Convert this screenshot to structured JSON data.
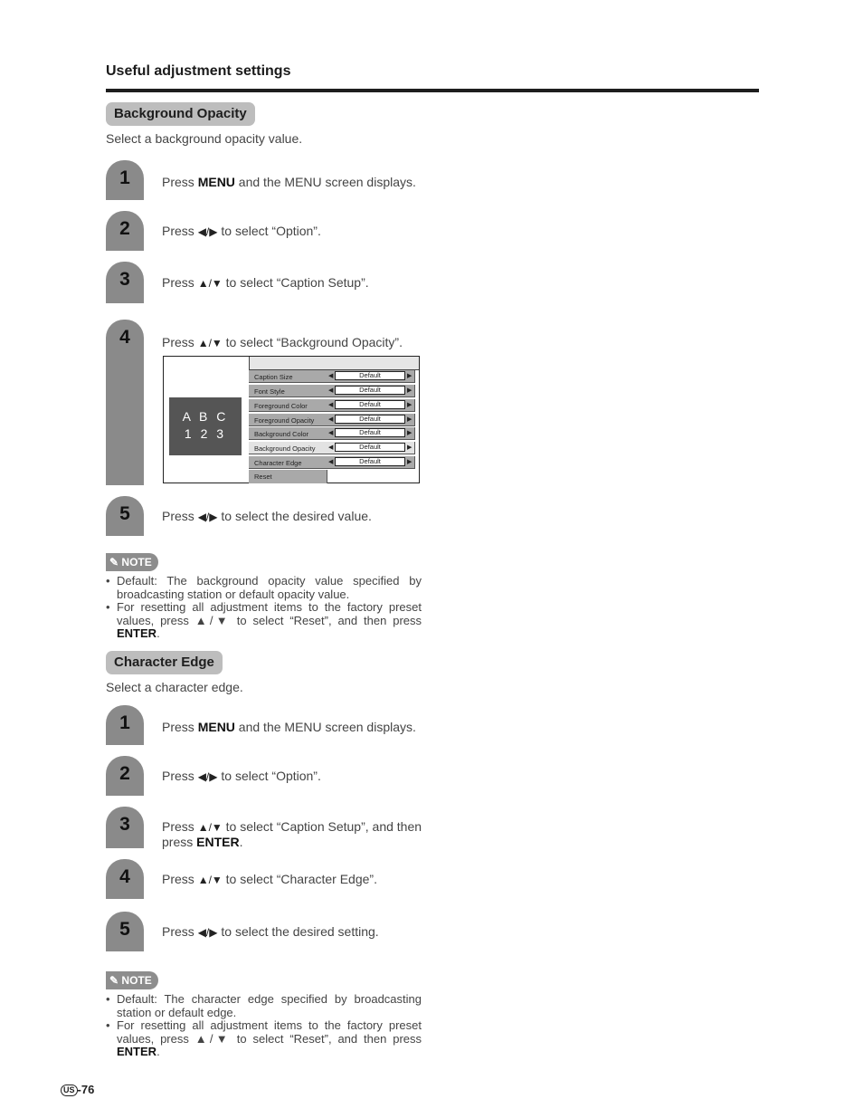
{
  "page_heading": "Useful adjustment settings",
  "sections": [
    {
      "title": "Background Opacity",
      "description": "Select a background opacity value.",
      "steps": [
        {
          "number": "1",
          "pre": "Press ",
          "bold": "MENU",
          "post": " and the MENU screen displays."
        },
        {
          "number": "2",
          "pre": "Press ",
          "glyph": "◀/▶",
          "post": " to select “Option”."
        },
        {
          "number": "3",
          "pre": "Press ",
          "glyph": "▲/▼",
          "post": " to select “Caption Setup”."
        },
        {
          "number": "4",
          "pre": "Press ",
          "glyph": "▲/▼",
          "post": " to select “Background Opacity”."
        },
        {
          "number": "5",
          "pre": "Press ",
          "glyph": "◀/▶",
          "post": " to select the desired value."
        }
      ],
      "note": {
        "badge": "NOTE",
        "items": [
          {
            "text": "Default: The background opacity value specified by broadcasting station or default opacity value."
          },
          {
            "text": "For resetting all adjustment items to the factory preset values, press ▲/▼ to select “Reset”, and then press ",
            "bold": "ENTER",
            "end": "."
          }
        ]
      }
    },
    {
      "title": "Character Edge",
      "description": "Select a character edge.",
      "steps": [
        {
          "number": "1",
          "pre": "Press ",
          "bold": "MENU",
          "post": " and the MENU screen displays."
        },
        {
          "number": "2",
          "pre": "Press ",
          "glyph": "◀/▶",
          "post": " to select “Option”."
        },
        {
          "number": "3",
          "pre": "Press ",
          "glyph": "▲/▼",
          "post": " to select “Caption Setup”, and then press ",
          "bold2": "ENTER",
          "end": "."
        },
        {
          "number": "4",
          "pre": "Press ",
          "glyph": "▲/▼",
          "post": " to select “Character Edge”."
        },
        {
          "number": "5",
          "pre": "Press ",
          "glyph": "◀/▶",
          "post": " to select the desired setting."
        }
      ],
      "note": {
        "badge": "NOTE",
        "items": [
          {
            "text": "Default: The character edge specified by broadcasting station or default edge."
          },
          {
            "text": "For resetting all adjustment items to the factory preset values, press ▲/▼ to select “Reset”, and then press ",
            "bold": "ENTER",
            "end": "."
          }
        ]
      }
    }
  ],
  "menu_screen": {
    "preview_line1": "A B C",
    "preview_line2": "1 2 3",
    "rows": [
      {
        "label": "Caption Size",
        "value": "Default",
        "selected": false
      },
      {
        "label": "Font Style",
        "value": "Default",
        "selected": false
      },
      {
        "label": "Foreground Color",
        "value": "Default",
        "selected": false
      },
      {
        "label": "Foreground Opacity",
        "value": "Default",
        "selected": false
      },
      {
        "label": "Background Color",
        "value": "Default",
        "selected": false
      },
      {
        "label": "Background Opacity",
        "value": "Default",
        "selected": true
      },
      {
        "label": "Character Edge",
        "value": "Default",
        "selected": false
      }
    ],
    "reset_label": "Reset",
    "arrow_left": "◀",
    "arrow_right": "▶"
  },
  "footer": {
    "region_badge": "US",
    "page_number": "-76"
  }
}
